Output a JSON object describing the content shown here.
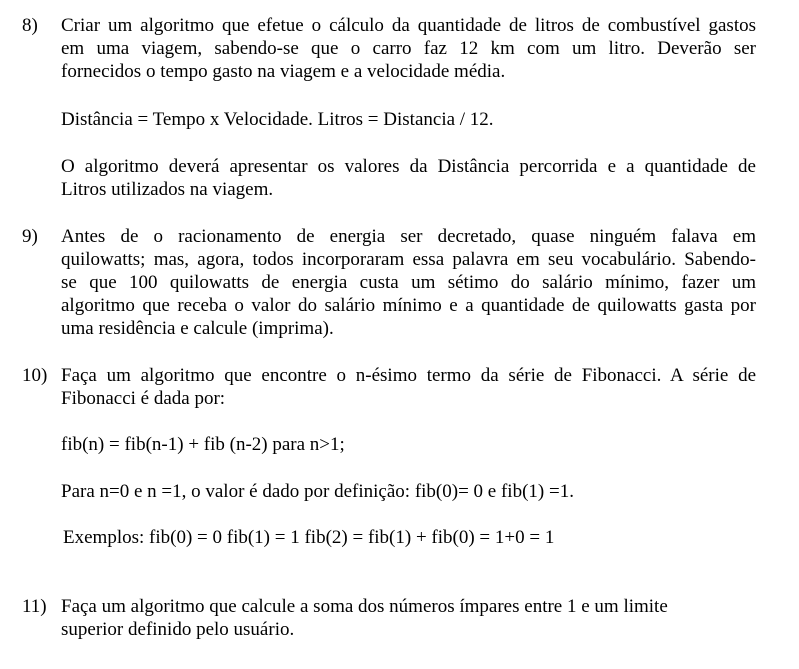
{
  "exercises": [
    {
      "number": "8)",
      "paragraphs": [
        {
          "lines": [
            "Criar um algoritmo que efetue o cálculo da quantidade de litros de combustível gastos",
            "em uma viagem, sabendo-se que o carro faz 12 km com um litro. Deverão ser",
            "fornecidos o tempo gasto na viagem e a velocidade média."
          ]
        },
        {
          "lines": [
            "Distância = Tempo x Velocidade. Litros = Distancia / 12."
          ]
        },
        {
          "lines": [
            "O algoritmo deverá apresentar os valores da Distância percorrida e a quantidade de",
            "Litros utilizados na viagem."
          ]
        }
      ]
    },
    {
      "number": "9)",
      "paragraphs": [
        {
          "lines": [
            "Antes de o racionamento de energia ser decretado, quase ninguém falava em",
            "quilowatts; mas, agora, todos incorporaram essa palavra em seu vocabulário. Sabendo-",
            "se que 100 quilowatts de energia custa um sétimo do salário mínimo, fazer um",
            "algoritmo que receba o valor do salário mínimo e a quantidade de quilowatts gasta por",
            "uma residência e calcule (imprima)."
          ]
        }
      ]
    },
    {
      "number": "10)",
      "paragraphs": [
        {
          "lines": [
            "Faça um algoritmo que encontre o n-ésimo termo da série de Fibonacci. A série de",
            "Fibonacci é dada por:"
          ]
        },
        {
          "lines": [
            "fib(n) = fib(n-1) + fib (n-2) para n>1;"
          ]
        },
        {
          "lines": [
            "Para n=0 e n =1, o valor é dado por definição: fib(0)= 0 e fib(1) =1."
          ]
        },
        {
          "lines": [
            "Exemplos: fib(0) = 0 fib(1) = 1 fib(2) = fib(1) + fib(0) = 1+0 = 1"
          ]
        }
      ]
    },
    {
      "number": "11)",
      "paragraphs": [
        {
          "lines": [
            "Faça um algoritmo que calcule a soma dos números ímpares entre 1 e um limite",
            "superior definido pelo usuário."
          ]
        }
      ]
    }
  ]
}
